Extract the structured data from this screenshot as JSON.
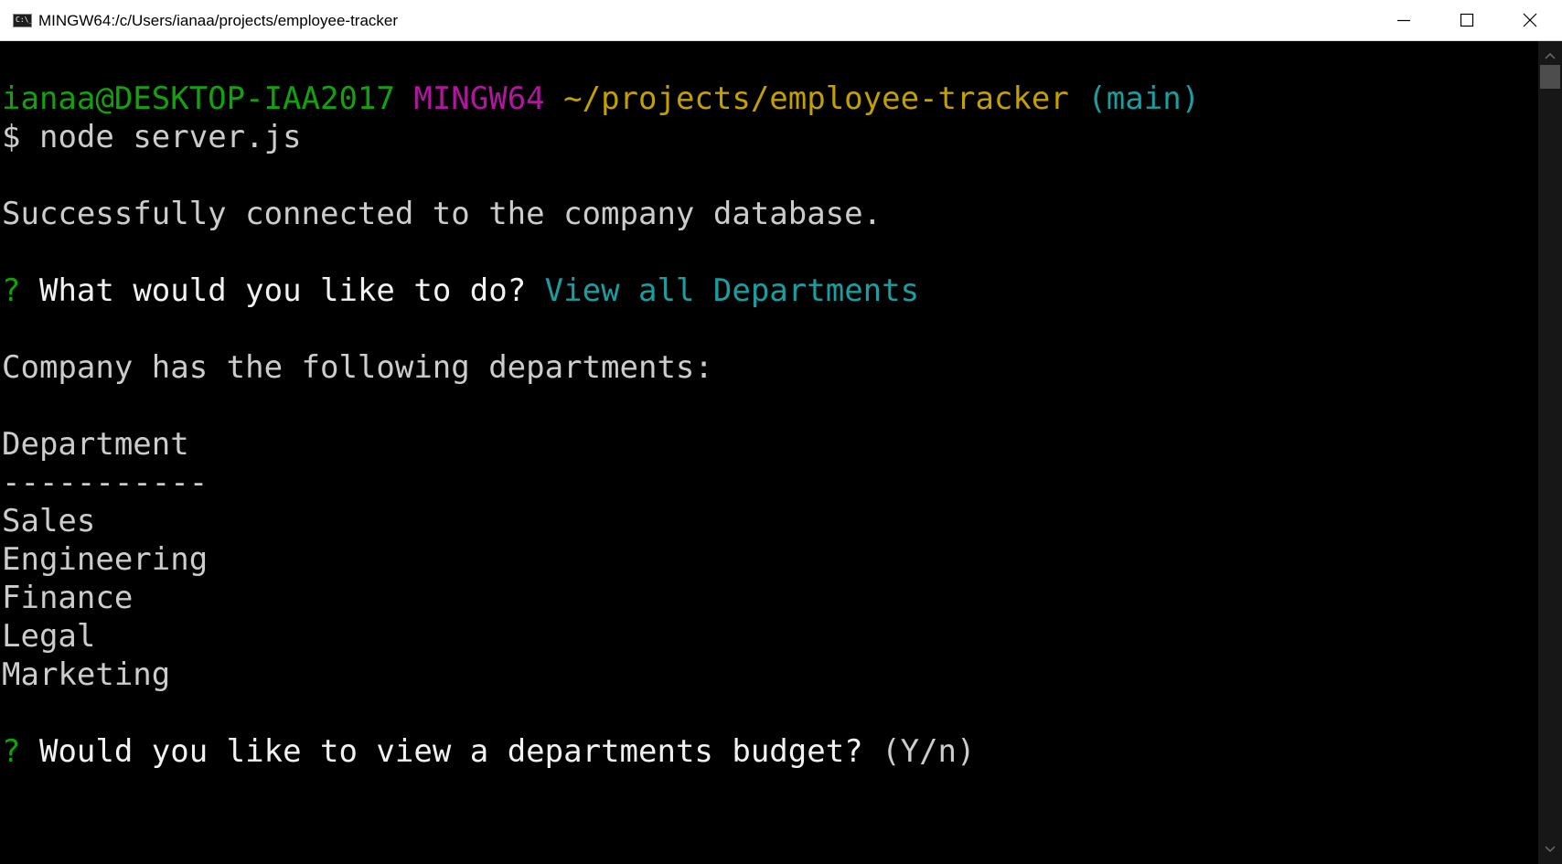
{
  "window": {
    "title": "MINGW64:/c/Users/ianaa/projects/employee-tracker",
    "icon_text": "C:\\_"
  },
  "controls": {
    "minimize_icon": "minimize-icon",
    "maximize_icon": "maximize-icon",
    "close_icon": "close-icon"
  },
  "colors": {
    "user_host": "#13a10e",
    "shell_name": "#b1169e",
    "path": "#c1a000",
    "branch": "#1a9ea0",
    "prompt_qmark": "#16c60c",
    "answer": "#1a9ea0",
    "text": "#cccccc",
    "background": "#000000"
  },
  "terminal": {
    "prompt": {
      "user_host": "ianaa@DESKTOP-IAA2017",
      "shell": "MINGW64",
      "path": "~/projects/employee-tracker",
      "branch": "(main)"
    },
    "command": {
      "symbol": "$",
      "text": "node server.js"
    },
    "connected_message": "Successfully connected to the company database.",
    "question1": {
      "qmark": "?",
      "text": "What would you like to do?",
      "answer": "View all Departments"
    },
    "departments_heading": "Company has the following departments:",
    "table_header": "Department",
    "table_rule": "-----------",
    "departments": [
      "Sales",
      "Engineering",
      "Finance",
      "Legal",
      "Marketing"
    ],
    "question2": {
      "qmark": "?",
      "text": "Would you like to view a departments budget?",
      "hint": "(Y/n)"
    }
  }
}
